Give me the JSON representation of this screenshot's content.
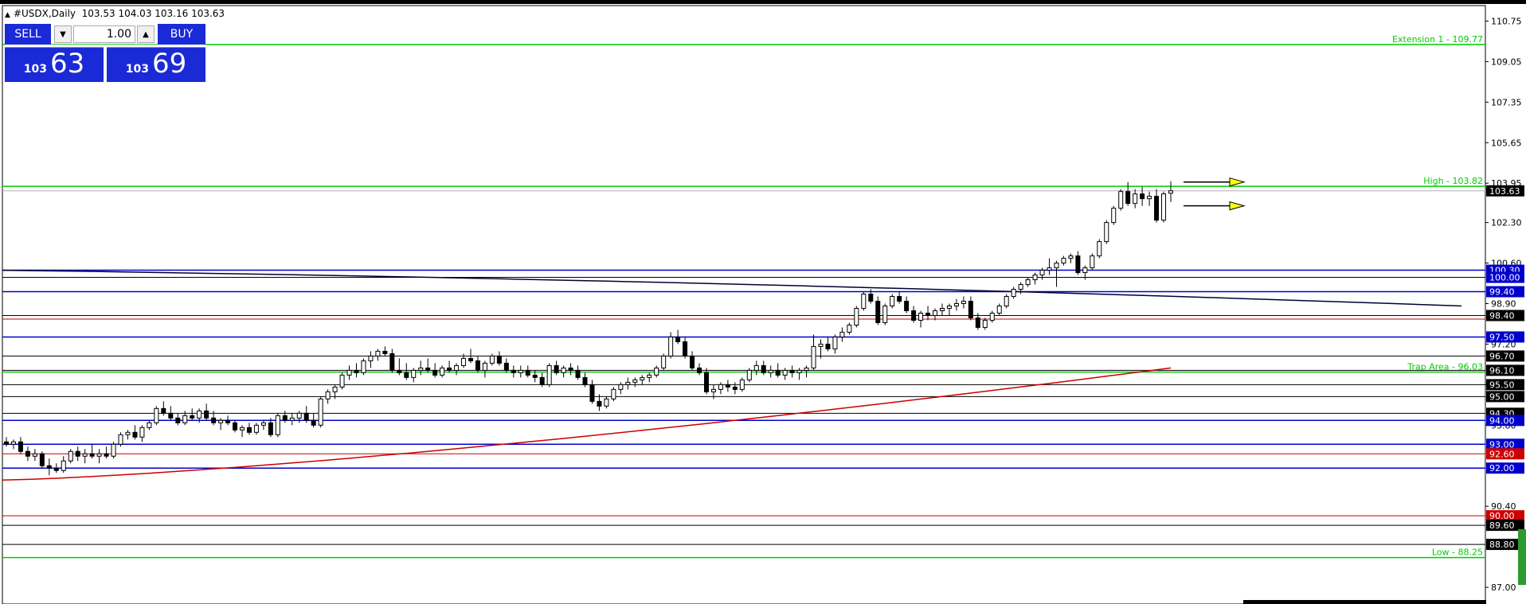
{
  "header": {
    "symbol": "#USDX,Daily",
    "ohlc": "103.53 104.03 103.16 103.63"
  },
  "trade_panel": {
    "sell_label": "SELL",
    "buy_label": "BUY",
    "lot_value": "1.00",
    "sell_price_small": "103",
    "sell_price_big": "63",
    "buy_price_small": "103",
    "buy_price_big": "69"
  },
  "chart_data": {
    "type": "candlestick",
    "ylim": [
      86.3,
      111.4
    ],
    "y_ticks": [
      "110.75",
      "109.05",
      "107.35",
      "105.65",
      "103.95",
      "102.30",
      "100.60",
      "98.90",
      "97.20",
      "95.50",
      "93.80",
      "90.40",
      "87.00"
    ],
    "current_price": "103.63",
    "candles": [
      {
        "o": 93.1,
        "h": 93.3,
        "l": 92.9,
        "c": 93.0
      },
      {
        "o": 93.0,
        "h": 93.2,
        "l": 92.8,
        "c": 93.1
      },
      {
        "o": 93.1,
        "h": 93.3,
        "l": 92.6,
        "c": 92.7
      },
      {
        "o": 92.7,
        "h": 92.9,
        "l": 92.3,
        "c": 92.5
      },
      {
        "o": 92.5,
        "h": 92.8,
        "l": 92.3,
        "c": 92.6
      },
      {
        "o": 92.6,
        "h": 92.7,
        "l": 92.0,
        "c": 92.1
      },
      {
        "o": 92.1,
        "h": 92.4,
        "l": 91.7,
        "c": 92.0
      },
      {
        "o": 92.0,
        "h": 92.2,
        "l": 91.8,
        "c": 91.9
      },
      {
        "o": 91.9,
        "h": 92.5,
        "l": 91.8,
        "c": 92.3
      },
      {
        "o": 92.3,
        "h": 92.8,
        "l": 92.2,
        "c": 92.7
      },
      {
        "o": 92.7,
        "h": 92.9,
        "l": 92.3,
        "c": 92.5
      },
      {
        "o": 92.5,
        "h": 92.8,
        "l": 92.2,
        "c": 92.6
      },
      {
        "o": 92.6,
        "h": 93.0,
        "l": 92.4,
        "c": 92.5
      },
      {
        "o": 92.5,
        "h": 92.8,
        "l": 92.2,
        "c": 92.6
      },
      {
        "o": 92.6,
        "h": 92.9,
        "l": 92.4,
        "c": 92.5
      },
      {
        "o": 92.5,
        "h": 93.1,
        "l": 92.4,
        "c": 93.0
      },
      {
        "o": 93.0,
        "h": 93.5,
        "l": 92.9,
        "c": 93.4
      },
      {
        "o": 93.4,
        "h": 93.6,
        "l": 93.2,
        "c": 93.5
      },
      {
        "o": 93.5,
        "h": 93.8,
        "l": 93.2,
        "c": 93.3
      },
      {
        "o": 93.3,
        "h": 93.8,
        "l": 93.1,
        "c": 93.7
      },
      {
        "o": 93.7,
        "h": 94.0,
        "l": 93.6,
        "c": 93.9
      },
      {
        "o": 93.9,
        "h": 94.6,
        "l": 93.8,
        "c": 94.5
      },
      {
        "o": 94.5,
        "h": 94.8,
        "l": 94.2,
        "c": 94.3
      },
      {
        "o": 94.3,
        "h": 94.6,
        "l": 94.0,
        "c": 94.1
      },
      {
        "o": 94.1,
        "h": 94.3,
        "l": 93.8,
        "c": 93.9
      },
      {
        "o": 93.9,
        "h": 94.4,
        "l": 93.8,
        "c": 94.2
      },
      {
        "o": 94.2,
        "h": 94.5,
        "l": 94.0,
        "c": 94.1
      },
      {
        "o": 94.1,
        "h": 94.5,
        "l": 93.9,
        "c": 94.4
      },
      {
        "o": 94.4,
        "h": 94.7,
        "l": 94.0,
        "c": 94.1
      },
      {
        "o": 94.1,
        "h": 94.4,
        "l": 93.8,
        "c": 93.9
      },
      {
        "o": 93.9,
        "h": 94.1,
        "l": 93.6,
        "c": 94.0
      },
      {
        "o": 94.0,
        "h": 94.2,
        "l": 93.8,
        "c": 93.9
      },
      {
        "o": 93.9,
        "h": 94.0,
        "l": 93.5,
        "c": 93.6
      },
      {
        "o": 93.6,
        "h": 93.8,
        "l": 93.3,
        "c": 93.7
      },
      {
        "o": 93.7,
        "h": 93.9,
        "l": 93.4,
        "c": 93.5
      },
      {
        "o": 93.5,
        "h": 93.9,
        "l": 93.4,
        "c": 93.8
      },
      {
        "o": 93.8,
        "h": 94.0,
        "l": 93.6,
        "c": 93.9
      },
      {
        "o": 93.9,
        "h": 94.1,
        "l": 93.3,
        "c": 93.4
      },
      {
        "o": 93.4,
        "h": 94.3,
        "l": 93.3,
        "c": 94.2
      },
      {
        "o": 94.2,
        "h": 94.4,
        "l": 93.9,
        "c": 94.0
      },
      {
        "o": 94.0,
        "h": 94.3,
        "l": 93.8,
        "c": 94.1
      },
      {
        "o": 94.1,
        "h": 94.4,
        "l": 93.9,
        "c": 94.3
      },
      {
        "o": 94.3,
        "h": 94.6,
        "l": 93.9,
        "c": 94.0
      },
      {
        "o": 94.0,
        "h": 94.3,
        "l": 93.7,
        "c": 93.8
      },
      {
        "o": 93.8,
        "h": 95.0,
        "l": 93.7,
        "c": 94.9
      },
      {
        "o": 94.9,
        "h": 95.3,
        "l": 94.7,
        "c": 95.2
      },
      {
        "o": 95.2,
        "h": 95.5,
        "l": 94.9,
        "c": 95.4
      },
      {
        "o": 95.4,
        "h": 96.0,
        "l": 95.3,
        "c": 95.9
      },
      {
        "o": 95.9,
        "h": 96.3,
        "l": 95.7,
        "c": 96.1
      },
      {
        "o": 96.1,
        "h": 96.4,
        "l": 95.8,
        "c": 96.0
      },
      {
        "o": 96.0,
        "h": 96.6,
        "l": 95.9,
        "c": 96.5
      },
      {
        "o": 96.5,
        "h": 96.9,
        "l": 96.2,
        "c": 96.7
      },
      {
        "o": 96.7,
        "h": 97.0,
        "l": 96.5,
        "c": 96.9
      },
      {
        "o": 96.9,
        "h": 97.1,
        "l": 96.7,
        "c": 96.8
      },
      {
        "o": 96.8,
        "h": 97.0,
        "l": 96.0,
        "c": 96.1
      },
      {
        "o": 96.1,
        "h": 96.6,
        "l": 95.9,
        "c": 96.0
      },
      {
        "o": 96.0,
        "h": 96.4,
        "l": 95.7,
        "c": 95.8
      },
      {
        "o": 95.8,
        "h": 96.2,
        "l": 95.6,
        "c": 96.1
      },
      {
        "o": 96.1,
        "h": 96.5,
        "l": 95.9,
        "c": 96.2
      },
      {
        "o": 96.2,
        "h": 96.6,
        "l": 96.0,
        "c": 96.1
      },
      {
        "o": 96.1,
        "h": 96.4,
        "l": 95.8,
        "c": 95.9
      },
      {
        "o": 95.9,
        "h": 96.3,
        "l": 95.8,
        "c": 96.2
      },
      {
        "o": 96.2,
        "h": 96.5,
        "l": 96.0,
        "c": 96.1
      },
      {
        "o": 96.1,
        "h": 96.4,
        "l": 95.9,
        "c": 96.3
      },
      {
        "o": 96.3,
        "h": 96.8,
        "l": 96.2,
        "c": 96.6
      },
      {
        "o": 96.6,
        "h": 97.0,
        "l": 96.4,
        "c": 96.5
      },
      {
        "o": 96.5,
        "h": 96.7,
        "l": 96.0,
        "c": 96.1
      },
      {
        "o": 96.1,
        "h": 96.5,
        "l": 95.8,
        "c": 96.4
      },
      {
        "o": 96.4,
        "h": 96.8,
        "l": 96.3,
        "c": 96.7
      },
      {
        "o": 96.7,
        "h": 96.9,
        "l": 96.3,
        "c": 96.4
      },
      {
        "o": 96.4,
        "h": 96.6,
        "l": 96.0,
        "c": 96.1
      },
      {
        "o": 96.1,
        "h": 96.3,
        "l": 95.8,
        "c": 96.0
      },
      {
        "o": 96.0,
        "h": 96.3,
        "l": 95.8,
        "c": 96.1
      },
      {
        "o": 96.1,
        "h": 96.3,
        "l": 95.8,
        "c": 95.9
      },
      {
        "o": 95.9,
        "h": 96.1,
        "l": 95.6,
        "c": 95.8
      },
      {
        "o": 95.8,
        "h": 96.0,
        "l": 95.4,
        "c": 95.5
      },
      {
        "o": 95.5,
        "h": 96.4,
        "l": 95.4,
        "c": 96.3
      },
      {
        "o": 96.3,
        "h": 96.5,
        "l": 95.9,
        "c": 96.0
      },
      {
        "o": 96.0,
        "h": 96.3,
        "l": 95.8,
        "c": 96.2
      },
      {
        "o": 96.2,
        "h": 96.4,
        "l": 95.9,
        "c": 96.1
      },
      {
        "o": 96.1,
        "h": 96.3,
        "l": 95.7,
        "c": 95.8
      },
      {
        "o": 95.8,
        "h": 96.0,
        "l": 95.4,
        "c": 95.5
      },
      {
        "o": 95.5,
        "h": 95.7,
        "l": 94.7,
        "c": 94.8
      },
      {
        "o": 94.8,
        "h": 95.1,
        "l": 94.4,
        "c": 94.6
      },
      {
        "o": 94.6,
        "h": 95.0,
        "l": 94.5,
        "c": 94.9
      },
      {
        "o": 94.9,
        "h": 95.4,
        "l": 94.8,
        "c": 95.3
      },
      {
        "o": 95.3,
        "h": 95.6,
        "l": 95.1,
        "c": 95.5
      },
      {
        "o": 95.5,
        "h": 95.8,
        "l": 95.3,
        "c": 95.6
      },
      {
        "o": 95.6,
        "h": 95.8,
        "l": 95.4,
        "c": 95.7
      },
      {
        "o": 95.7,
        "h": 95.9,
        "l": 95.5,
        "c": 95.8
      },
      {
        "o": 95.8,
        "h": 96.0,
        "l": 95.6,
        "c": 95.9
      },
      {
        "o": 95.9,
        "h": 96.3,
        "l": 95.8,
        "c": 96.2
      },
      {
        "o": 96.2,
        "h": 96.8,
        "l": 96.1,
        "c": 96.7
      },
      {
        "o": 96.7,
        "h": 97.7,
        "l": 96.6,
        "c": 97.5
      },
      {
        "o": 97.5,
        "h": 97.8,
        "l": 97.2,
        "c": 97.3
      },
      {
        "o": 97.3,
        "h": 97.5,
        "l": 96.6,
        "c": 96.7
      },
      {
        "o": 96.7,
        "h": 96.9,
        "l": 96.1,
        "c": 96.2
      },
      {
        "o": 96.2,
        "h": 96.4,
        "l": 95.9,
        "c": 96.0
      },
      {
        "o": 96.0,
        "h": 96.2,
        "l": 95.1,
        "c": 95.2
      },
      {
        "o": 95.2,
        "h": 95.5,
        "l": 94.9,
        "c": 95.3
      },
      {
        "o": 95.3,
        "h": 95.6,
        "l": 95.1,
        "c": 95.5
      },
      {
        "o": 95.5,
        "h": 95.7,
        "l": 95.2,
        "c": 95.4
      },
      {
        "o": 95.4,
        "h": 95.6,
        "l": 95.1,
        "c": 95.3
      },
      {
        "o": 95.3,
        "h": 95.8,
        "l": 95.2,
        "c": 95.7
      },
      {
        "o": 95.7,
        "h": 96.2,
        "l": 95.6,
        "c": 96.1
      },
      {
        "o": 96.1,
        "h": 96.5,
        "l": 95.9,
        "c": 96.3
      },
      {
        "o": 96.3,
        "h": 96.5,
        "l": 95.9,
        "c": 96.0
      },
      {
        "o": 96.0,
        "h": 96.3,
        "l": 95.8,
        "c": 96.1
      },
      {
        "o": 96.1,
        "h": 96.4,
        "l": 95.8,
        "c": 95.9
      },
      {
        "o": 95.9,
        "h": 96.2,
        "l": 95.7,
        "c": 96.1
      },
      {
        "o": 96.1,
        "h": 96.3,
        "l": 95.8,
        "c": 96.0
      },
      {
        "o": 96.0,
        "h": 96.2,
        "l": 95.7,
        "c": 96.1
      },
      {
        "o": 96.1,
        "h": 96.3,
        "l": 95.8,
        "c": 96.2
      },
      {
        "o": 96.2,
        "h": 97.6,
        "l": 96.1,
        "c": 97.1
      },
      {
        "o": 97.1,
        "h": 97.4,
        "l": 96.6,
        "c": 97.2
      },
      {
        "o": 97.2,
        "h": 97.5,
        "l": 96.9,
        "c": 97.0
      },
      {
        "o": 97.0,
        "h": 97.6,
        "l": 96.8,
        "c": 97.5
      },
      {
        "o": 97.5,
        "h": 97.9,
        "l": 97.3,
        "c": 97.7
      },
      {
        "o": 97.7,
        "h": 98.1,
        "l": 97.6,
        "c": 98.0
      },
      {
        "o": 98.0,
        "h": 98.8,
        "l": 97.9,
        "c": 98.7
      },
      {
        "o": 98.7,
        "h": 99.4,
        "l": 98.6,
        "c": 99.3
      },
      {
        "o": 99.3,
        "h": 99.5,
        "l": 98.9,
        "c": 99.0
      },
      {
        "o": 99.0,
        "h": 99.2,
        "l": 98.0,
        "c": 98.1
      },
      {
        "o": 98.1,
        "h": 98.9,
        "l": 98.0,
        "c": 98.8
      },
      {
        "o": 98.8,
        "h": 99.3,
        "l": 98.7,
        "c": 99.2
      },
      {
        "o": 99.2,
        "h": 99.4,
        "l": 98.9,
        "c": 99.0
      },
      {
        "o": 99.0,
        "h": 99.2,
        "l": 98.5,
        "c": 98.6
      },
      {
        "o": 98.6,
        "h": 98.8,
        "l": 98.1,
        "c": 98.2
      },
      {
        "o": 98.2,
        "h": 98.6,
        "l": 97.9,
        "c": 98.5
      },
      {
        "o": 98.5,
        "h": 98.8,
        "l": 98.2,
        "c": 98.4
      },
      {
        "o": 98.4,
        "h": 98.7,
        "l": 98.2,
        "c": 98.6
      },
      {
        "o": 98.6,
        "h": 98.9,
        "l": 98.4,
        "c": 98.7
      },
      {
        "o": 98.7,
        "h": 98.9,
        "l": 98.4,
        "c": 98.8
      },
      {
        "o": 98.8,
        "h": 99.1,
        "l": 98.6,
        "c": 98.9
      },
      {
        "o": 98.9,
        "h": 99.2,
        "l": 98.7,
        "c": 99.0
      },
      {
        "o": 99.0,
        "h": 99.2,
        "l": 98.2,
        "c": 98.3
      },
      {
        "o": 98.3,
        "h": 98.5,
        "l": 97.8,
        "c": 97.9
      },
      {
        "o": 97.9,
        "h": 98.3,
        "l": 97.8,
        "c": 98.2
      },
      {
        "o": 98.2,
        "h": 98.6,
        "l": 98.1,
        "c": 98.5
      },
      {
        "o": 98.5,
        "h": 98.9,
        "l": 98.4,
        "c": 98.8
      },
      {
        "o": 98.8,
        "h": 99.3,
        "l": 98.7,
        "c": 99.2
      },
      {
        "o": 99.2,
        "h": 99.6,
        "l": 99.1,
        "c": 99.5
      },
      {
        "o": 99.5,
        "h": 99.8,
        "l": 99.3,
        "c": 99.7
      },
      {
        "o": 99.7,
        "h": 100.0,
        "l": 99.6,
        "c": 99.9
      },
      {
        "o": 99.9,
        "h": 100.2,
        "l": 99.7,
        "c": 100.1
      },
      {
        "o": 100.1,
        "h": 100.4,
        "l": 99.9,
        "c": 100.3
      },
      {
        "o": 100.3,
        "h": 100.8,
        "l": 100.1,
        "c": 100.4
      },
      {
        "o": 100.4,
        "h": 100.7,
        "l": 99.6,
        "c": 100.6
      },
      {
        "o": 100.6,
        "h": 100.9,
        "l": 100.5,
        "c": 100.8
      },
      {
        "o": 100.8,
        "h": 101.0,
        "l": 100.6,
        "c": 100.9
      },
      {
        "o": 100.9,
        "h": 101.1,
        "l": 100.1,
        "c": 100.2
      },
      {
        "o": 100.2,
        "h": 100.5,
        "l": 99.9,
        "c": 100.4
      },
      {
        "o": 100.4,
        "h": 101.0,
        "l": 100.3,
        "c": 100.9
      },
      {
        "o": 100.9,
        "h": 101.6,
        "l": 100.8,
        "c": 101.5
      },
      {
        "o": 101.5,
        "h": 102.4,
        "l": 101.4,
        "c": 102.3
      },
      {
        "o": 102.3,
        "h": 103.0,
        "l": 102.2,
        "c": 102.9
      },
      {
        "o": 102.9,
        "h": 103.7,
        "l": 102.8,
        "c": 103.6
      },
      {
        "o": 103.6,
        "h": 104.0,
        "l": 103.0,
        "c": 103.1
      },
      {
        "o": 103.1,
        "h": 103.7,
        "l": 102.9,
        "c": 103.5
      },
      {
        "o": 103.5,
        "h": 103.8,
        "l": 103.0,
        "c": 103.3
      },
      {
        "o": 103.3,
        "h": 103.6,
        "l": 103.0,
        "c": 103.4
      },
      {
        "o": 103.4,
        "h": 103.7,
        "l": 102.3,
        "c": 102.4
      },
      {
        "o": 102.4,
        "h": 103.6,
        "l": 102.3,
        "c": 103.5
      },
      {
        "o": 103.53,
        "h": 104.03,
        "l": 103.16,
        "c": 103.63
      }
    ],
    "ma_red": {
      "start": 91.5,
      "end": 96.2
    },
    "ma_dark": {
      "start": 100.3,
      "end": 98.8
    },
    "horizontal_levels": [
      {
        "value": 109.77,
        "color": "#00cc00",
        "label": "Extension 1 - 109.77",
        "tag": ""
      },
      {
        "value": 103.82,
        "color": "#00cc00",
        "label": "High - 103.82",
        "tag": ""
      },
      {
        "value": 103.63,
        "color": "#b0b0b0",
        "label": "",
        "tag": "103.63",
        "tagColor": "#000000"
      },
      {
        "value": 100.3,
        "color": "#0000cc",
        "label": "",
        "tag": "100.30",
        "tagColor": "#0000cc"
      },
      {
        "value": 100.0,
        "color": "#000000",
        "label": "",
        "tag": "100.00",
        "tagColor": "#0000cc"
      },
      {
        "value": 99.4,
        "color": "#0000cc",
        "label": "",
        "tag": "99.40",
        "tagColor": "#0000cc"
      },
      {
        "value": 98.4,
        "color": "#000000",
        "label": "",
        "tag": "98.40",
        "tagColor": "#000000"
      },
      {
        "value": 98.25,
        "color": "#cc0000",
        "label": "",
        "tag": "",
        "tagColor": ""
      },
      {
        "value": 97.5,
        "color": "#0000cc",
        "label": "",
        "tag": "97.50",
        "tagColor": "#0000cc"
      },
      {
        "value": 96.7,
        "color": "#000000",
        "label": "",
        "tag": "96.70",
        "tagColor": "#000000"
      },
      {
        "value": 96.03,
        "color": "#00cc00",
        "label": "Trap Area - 96.03",
        "tag": ""
      },
      {
        "value": 96.1,
        "color": "#000000",
        "label": "",
        "tag": "96.10",
        "tagColor": "#000000"
      },
      {
        "value": 95.5,
        "color": "#000000",
        "label": "",
        "tag": "95.50",
        "tagColor": "#000000"
      },
      {
        "value": 95.0,
        "color": "#000000",
        "label": "",
        "tag": "95.00",
        "tagColor": "#000000"
      },
      {
        "value": 94.3,
        "color": "#000000",
        "label": "",
        "tag": "94.30",
        "tagColor": "#000000"
      },
      {
        "value": 94.0,
        "color": "#0000cc",
        "label": "",
        "tag": "94.00",
        "tagColor": "#0000cc"
      },
      {
        "value": 93.0,
        "color": "#0000cc",
        "label": "",
        "tag": "93.00",
        "tagColor": "#0000cc"
      },
      {
        "value": 92.6,
        "color": "#cc0000",
        "label": "",
        "tag": "92.60",
        "tagColor": "#cc0000"
      },
      {
        "value": 92.0,
        "color": "#0000cc",
        "label": "",
        "tag": "92.00",
        "tagColor": "#0000cc"
      },
      {
        "value": 90.0,
        "color": "#cc0000",
        "label": "",
        "tag": "90.00",
        "tagColor": "#cc0000"
      },
      {
        "value": 89.6,
        "color": "#000000",
        "label": "",
        "tag": "89.60",
        "tagColor": "#000000"
      },
      {
        "value": 88.8,
        "color": "#000000",
        "label": "",
        "tag": "88.80",
        "tagColor": "#000000"
      },
      {
        "value": 88.25,
        "color": "#00cc00",
        "label": "Low - 88.25",
        "tag": ""
      }
    ],
    "arrows": [
      {
        "value": 104.0,
        "color": "#ffff00"
      },
      {
        "value": 103.0,
        "color": "#ffff00"
      }
    ]
  }
}
